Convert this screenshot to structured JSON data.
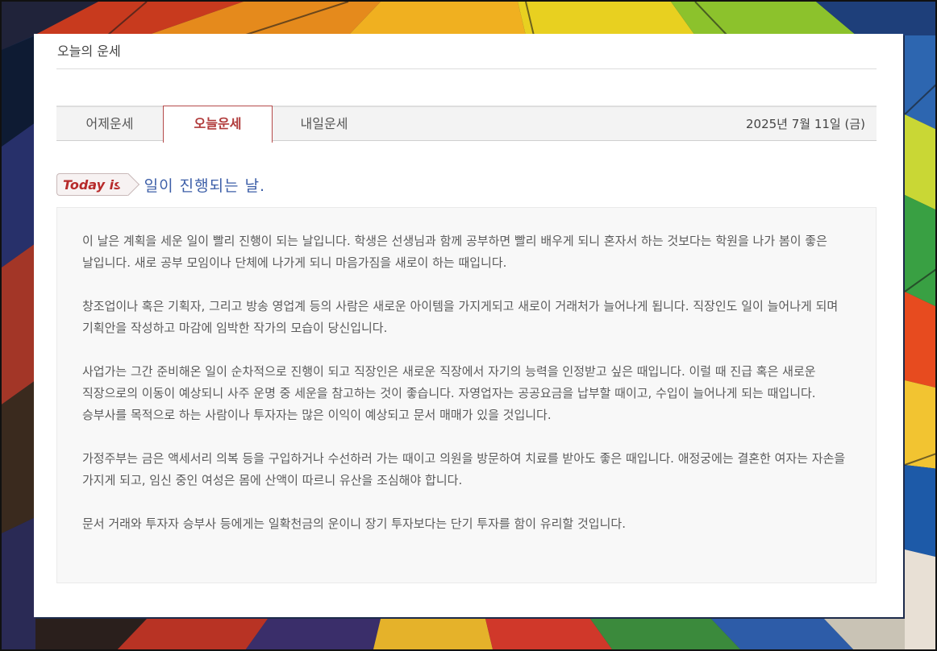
{
  "page": {
    "title": "오늘의 운세"
  },
  "tabs": {
    "yesterday": "어제운세",
    "today": "오늘운세",
    "tomorrow": "내일운세"
  },
  "date": "2025년 7월 11일 (금)",
  "headline": {
    "badge": "Today is",
    "text": "일이 진행되는 날."
  },
  "paragraphs": [
    "이 날은 계획을 세운 일이 빨리 진행이 되는 날입니다. 학생은 선생님과 함께 공부하면 빨리 배우게 되니 혼자서 하는 것보다는 학원을 나가 봄이 좋은 날입니다. 새로 공부 모임이나 단체에 나가게 되니 마음가짐을 새로이 하는 때입니다.",
    "창조업이나 혹은 기획자, 그리고 방송 영업계 등의 사람은 새로운 아이템을 가지게되고 새로이 거래처가 늘어나게 됩니다. 직장인도 일이 늘어나게 되며 기획안을 작성하고 마감에 임박한 작가의 모습이 당신입니다.",
    "사업가는 그간 준비해온 일이 순차적으로 진행이 되고 직장인은 새로운 직장에서 자기의 능력을 인정받고 싶은 때입니다. 이럴 때 진급 혹은 새로운 직장으로의 이동이 예상되니 사주 운명 중 세운을 참고하는 것이 좋습니다. 자영업자는 공공요금을 납부할 때이고, 수입이 늘어나게 되는 때입니다. 승부사를 목적으로 하는 사람이나 투자자는 많은 이익이 예상되고 문서 매매가 있을 것입니다.",
    "가정주부는 금은 액세서리 의복 등을 구입하거나 수선하러 가는 때이고 의원을 방문하여 치료를 받아도 좋은 때입니다. 애정궁에는 결혼한 여자는 자손을 가지게 되고, 임신 중인 여성은 몸에 산액이 따르니 유산을 조심해야 합니다.",
    "문서 거래와 투자자 승부사 등에게는 일확천금의 운이니 장기 투자보다는 단기 투자를 함이 유리할 것입니다."
  ],
  "colors": {
    "active_tab": "#b03a3a",
    "headline": "#3d5fa8",
    "badge_text": "#b72a2a",
    "body_text": "#5a5a5a"
  }
}
